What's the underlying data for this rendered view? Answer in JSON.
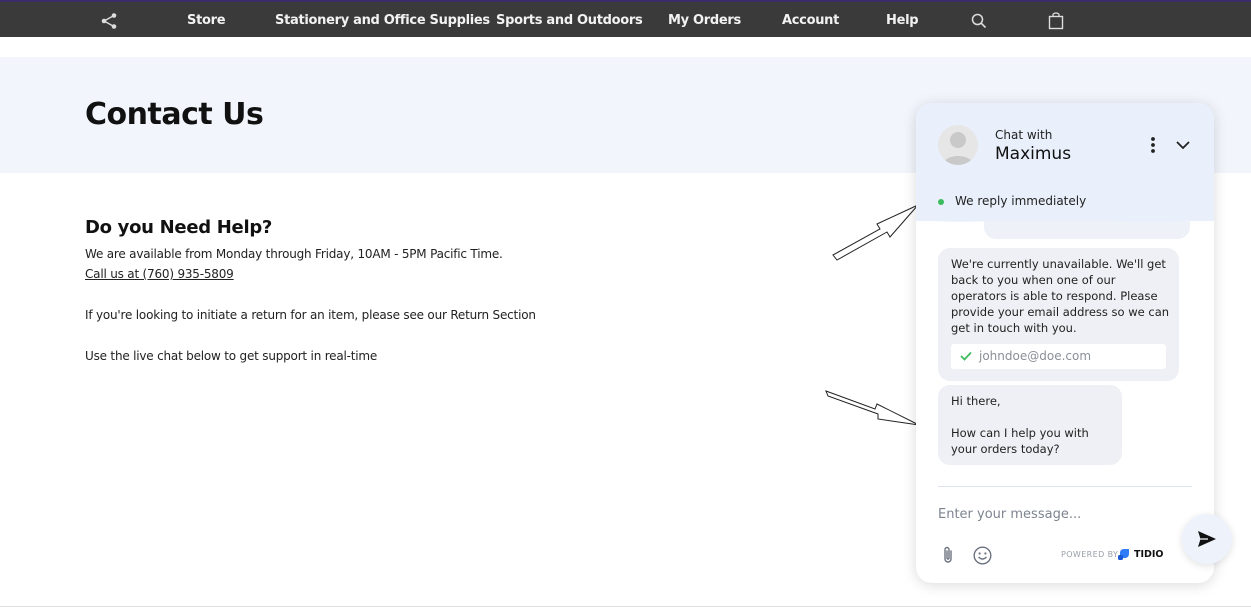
{
  "nav": {
    "items": [
      {
        "label": "Store"
      },
      {
        "label": "Stationery and Office Supplies"
      },
      {
        "label": "Sports and Outdoors"
      },
      {
        "label": "My Orders"
      },
      {
        "label": "Account"
      },
      {
        "label": "Help"
      }
    ],
    "icons": {
      "share": "share-icon",
      "search": "search-icon",
      "cart": "shopping-bag-icon"
    }
  },
  "hero": {
    "title": "Contact Us"
  },
  "help": {
    "title": "Do you Need Help?",
    "availability": "We are available from Monday through Friday, 10AM - 5PM Pacific Time.",
    "phone_link": "Call us at (760) 935-5809",
    "return_text": "If you're looking to initiate a return for an item, please see our Return Section",
    "chat_text": "Use the live chat below to get support in real-time"
  },
  "chat": {
    "chat_with": "Chat with",
    "agent": "Maximus",
    "status": "We reply immediately",
    "status_color": "#3dbb5f",
    "messages": [
      {
        "text": "We're currently unavailable. We'll get back to you when one of our operators is able to respond. Please provide your email address so we can get in touch with you.",
        "email_value": "johndoe@doe.com"
      },
      {
        "text": "Hi there,\n\nHow can I help you with your orders today?"
      }
    ],
    "input_placeholder": "Enter your message...",
    "powered_by": "POWERED BY",
    "brand": "TIDIO"
  },
  "colors": {
    "nav_bg": "#3a3a3a",
    "hero_bg": "#f2f6fc",
    "chat_header_bg": "#e9f0fb",
    "bubble_bg": "#eef0f5"
  }
}
